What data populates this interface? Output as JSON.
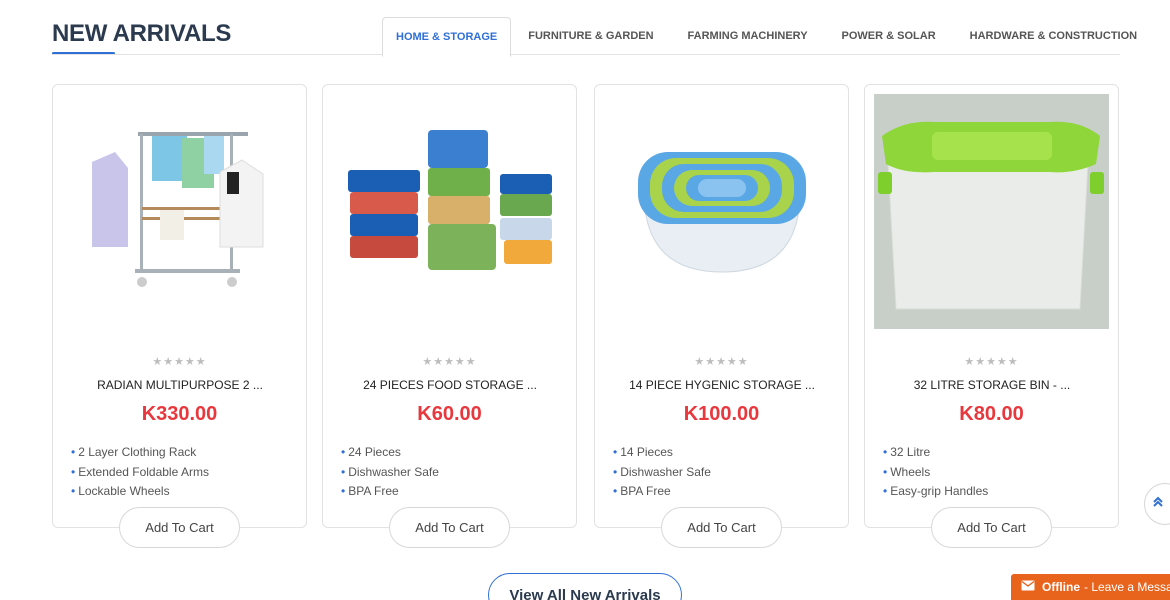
{
  "section": {
    "title": "NEW ARRIVALS",
    "tabs": [
      {
        "label": "HOME & STORAGE",
        "active": true
      },
      {
        "label": "FURNITURE & GARDEN",
        "active": false
      },
      {
        "label": "FARMING MACHINERY",
        "active": false
      },
      {
        "label": "POWER & SOLAR",
        "active": false
      },
      {
        "label": "HARDWARE & CONSTRUCTION",
        "active": false
      }
    ]
  },
  "products": [
    {
      "name": "RADIAN MULTIPURPOSE 2 ...",
      "price": "K330.00",
      "stars": "★★★★★",
      "features": [
        "2 Layer Clothing Rack",
        "Extended Foldable Arms",
        "Lockable Wheels"
      ],
      "cart_label": "Add To Cart",
      "image": "clothing-rack"
    },
    {
      "name": "24 PIECES FOOD STORAGE ...",
      "price": "K60.00",
      "stars": "★★★★★",
      "features": [
        "24 Pieces",
        "Dishwasher Safe",
        "BPA Free"
      ],
      "cart_label": "Add To Cart",
      "image": "food-containers"
    },
    {
      "name": "14 PIECE HYGENIC STORAGE ...",
      "price": "K100.00",
      "stars": "★★★★★",
      "features": [
        "14 Pieces",
        "Dishwasher Safe",
        "BPA Free"
      ],
      "cart_label": "Add To Cart",
      "image": "nested-containers"
    },
    {
      "name": "32 LITRE STORAGE BIN - ...",
      "price": "K80.00",
      "stars": "★★★★★",
      "features": [
        "32 Litre",
        "Wheels",
        "Easy-grip Handles"
      ],
      "cart_label": "Add To Cart",
      "image": "storage-bin"
    }
  ],
  "view_all_label": "View All New Arrivals",
  "chat": {
    "status": "Offline",
    "message": "- Leave a Message",
    "icon": "envelope-icon"
  },
  "scroll_top_icon": "double-chevron-up-icon",
  "colors": {
    "accent": "#2f6fd6",
    "price": "#e8383d",
    "chat": "#e8641c",
    "title": "#2b3a4e"
  }
}
